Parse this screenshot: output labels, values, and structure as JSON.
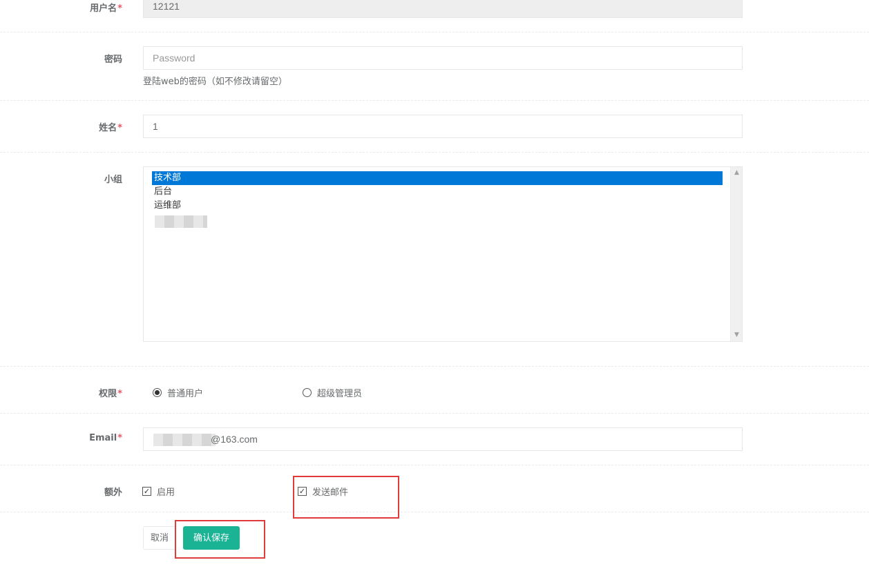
{
  "form": {
    "username": {
      "label": "用户名",
      "value": "12121"
    },
    "password": {
      "label": "密码",
      "placeholder": "Password",
      "help": "登陆web的密码（如不修改请留空）"
    },
    "name": {
      "label": "姓名",
      "value": "1"
    },
    "group": {
      "label": "小组",
      "options": [
        "技术部",
        "后台",
        "运维部"
      ],
      "selected": "技术部"
    },
    "permission": {
      "label": "权限",
      "options": [
        {
          "label": "普通用户",
          "checked": true
        },
        {
          "label": "超级管理员",
          "checked": false
        }
      ]
    },
    "email": {
      "label": "Email",
      "value_suffix": "@163.com"
    },
    "extra": {
      "label": "额外",
      "options": [
        {
          "label": "启用",
          "checked": true
        },
        {
          "label": "发送邮件",
          "checked": true
        }
      ]
    },
    "required_marker": "*"
  },
  "buttons": {
    "cancel": "取消",
    "save": "确认保存"
  },
  "colors": {
    "primary": "#1ab394",
    "required": "#ed5565",
    "selection": "#0078d7",
    "annotation": "#e03c3c"
  }
}
